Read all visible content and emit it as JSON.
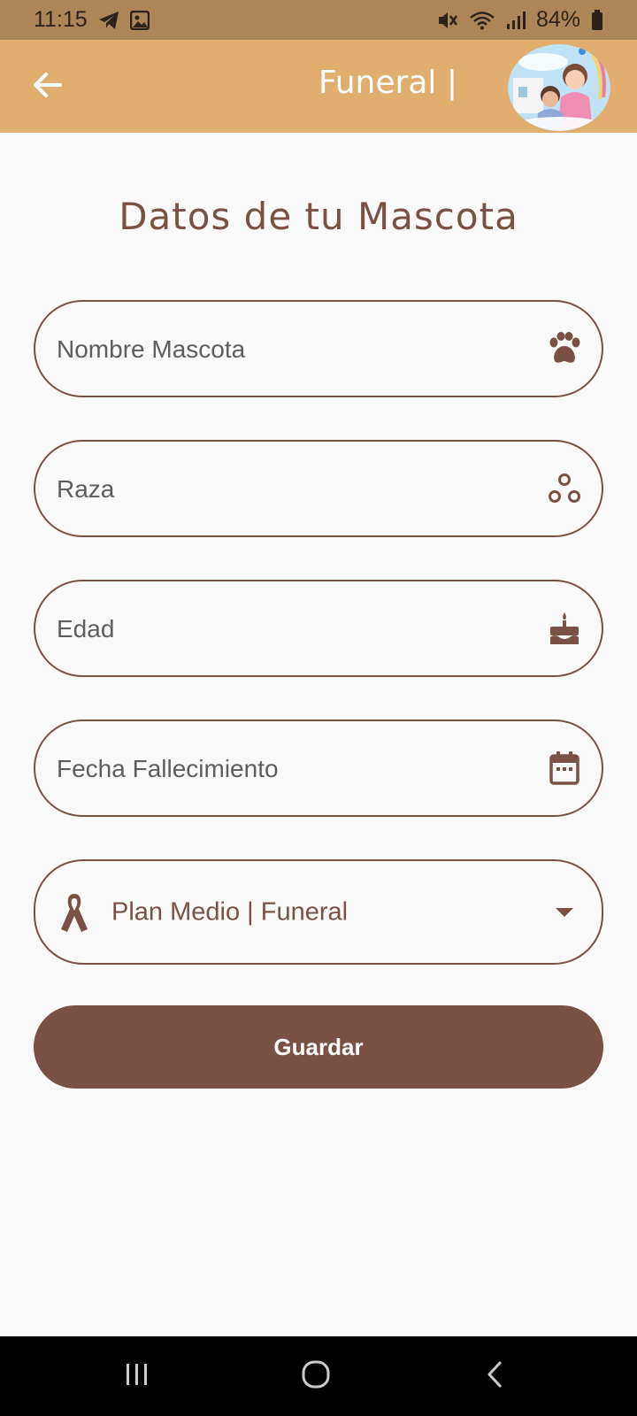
{
  "status_bar": {
    "time": "11:15",
    "left_icons": [
      "telegram-icon",
      "gallery-icon"
    ],
    "right_icons": [
      "mute-icon",
      "wifi-icon",
      "signal-icon"
    ],
    "battery": "84%"
  },
  "app_bar": {
    "title": "Funeral |",
    "back_icon": "arrow-left-icon"
  },
  "page": {
    "title": "Datos de tu Mascota"
  },
  "form": {
    "fields": [
      {
        "placeholder": "Nombre Mascota",
        "value": "",
        "icon": "paw-icon"
      },
      {
        "placeholder": "Raza",
        "value": "",
        "icon": "breed-icon"
      },
      {
        "placeholder": "Edad",
        "value": "",
        "icon": "cake-icon"
      },
      {
        "placeholder": "Fecha Fallecimiento",
        "value": "",
        "icon": "calendar-icon"
      }
    ],
    "plan": {
      "selected": "Plan Medio | Funeral",
      "icon": "ribbon-icon"
    },
    "submit_label": "Guardar"
  },
  "nav_bar": {
    "icons": [
      "recent-apps-icon",
      "home-icon",
      "back-icon"
    ]
  },
  "colors": {
    "status_bar": "#AD8658",
    "app_bar": "#E1AE6F",
    "primary": "#7A5245",
    "background": "#FAFAFA"
  }
}
